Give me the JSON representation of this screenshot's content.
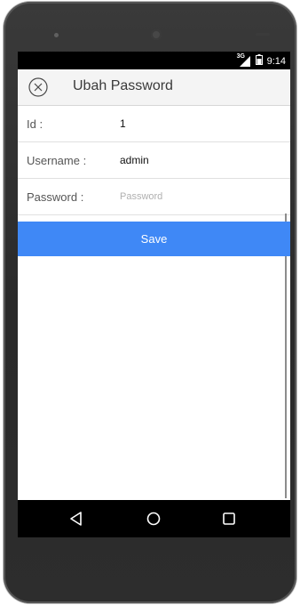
{
  "statusbar": {
    "network_label": "3G",
    "time": "9:14"
  },
  "appbar": {
    "close_icon": "close-circle-icon",
    "title": "Ubah Password"
  },
  "form": {
    "id": {
      "label": "Id :",
      "value": "1"
    },
    "username": {
      "label": "Username :",
      "value": "admin"
    },
    "password": {
      "label": "Password :",
      "value": "",
      "placeholder": "Password"
    }
  },
  "save_button": {
    "label": "Save"
  },
  "navbar": {
    "back_icon": "triangle-back-icon",
    "home_icon": "circle-home-icon",
    "recents_icon": "square-recents-icon"
  },
  "colors": {
    "accent": "#3f88f6",
    "appbar_bg": "#f4f4f4",
    "device_body": "#2f2f2f"
  }
}
